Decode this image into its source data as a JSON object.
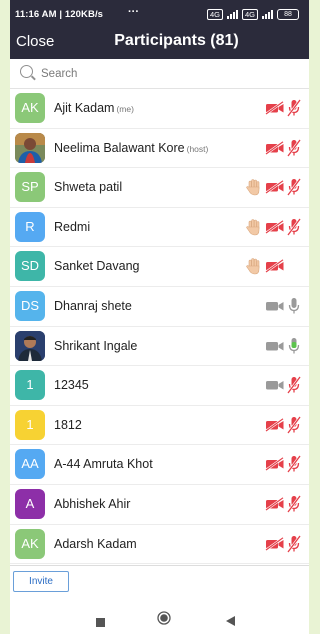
{
  "status_bar": {
    "time": "11:16 AM | 120KB/s",
    "more": "···",
    "net1": "4G",
    "net2": "4G",
    "battery": "88"
  },
  "header": {
    "close_label": "Close",
    "title": "Participants (81)"
  },
  "search": {
    "placeholder": "Search"
  },
  "participants": [
    {
      "initials": "AK",
      "name": "Ajit Kadam",
      "tag": "(me)",
      "avatar_color": "#8bc878",
      "photo": false,
      "hand": false,
      "video": "off",
      "audio": "muted"
    },
    {
      "initials": "",
      "name": "Neelima Balawant Kore",
      "tag": "(host)",
      "avatar_color": "#7a4a36",
      "photo": true,
      "hand": false,
      "video": "off",
      "audio": "muted"
    },
    {
      "initials": "SP",
      "name": "Shweta patil",
      "tag": "",
      "avatar_color": "#8bc878",
      "photo": false,
      "hand": true,
      "video": "off",
      "audio": "muted"
    },
    {
      "initials": "R",
      "name": "Redmi",
      "tag": "",
      "avatar_color": "#55a9f2",
      "photo": false,
      "hand": true,
      "video": "off",
      "audio": "muted"
    },
    {
      "initials": "SD",
      "name": "Sanket Davang",
      "tag": "",
      "avatar_color": "#3eb6a8",
      "photo": false,
      "hand": true,
      "video": "off",
      "audio": "none"
    },
    {
      "initials": "DS",
      "name": "Dhanraj shete",
      "tag": "",
      "avatar_color": "#55b4ec",
      "photo": false,
      "hand": false,
      "video": "on",
      "audio": "on"
    },
    {
      "initials": "",
      "name": "Shrikant Ingale",
      "tag": "",
      "avatar_color": "#2a3f6e",
      "photo": true,
      "hand": false,
      "video": "on",
      "audio": "speaking"
    },
    {
      "initials": "1",
      "name": "12345",
      "tag": "",
      "avatar_color": "#3eb6a8",
      "photo": false,
      "hand": false,
      "video": "on",
      "audio": "muted"
    },
    {
      "initials": "1",
      "name": "1812",
      "tag": "",
      "avatar_color": "#f7d233",
      "photo": false,
      "hand": false,
      "video": "off",
      "audio": "muted"
    },
    {
      "initials": "AA",
      "name": "A-44 Amruta Khot",
      "tag": "",
      "avatar_color": "#55a9f2",
      "photo": false,
      "hand": false,
      "video": "off",
      "audio": "muted"
    },
    {
      "initials": "A",
      "name": "Abhishek Ahir",
      "tag": "",
      "avatar_color": "#8d2fa8",
      "photo": false,
      "hand": false,
      "video": "off",
      "audio": "muted"
    },
    {
      "initials": "AK",
      "name": "Adarsh Kadam",
      "tag": "",
      "avatar_color": "#8bc878",
      "photo": false,
      "hand": false,
      "video": "off",
      "audio": "muted"
    }
  ],
  "footer": {
    "invite_label": "Invite"
  },
  "colors": {
    "header_bg": "#2b2b3b",
    "muted_red": "#e5404a",
    "icon_grey": "#9a9a9a",
    "speaking_green": "#5cc34d",
    "hand_skin": "#f2c9a6"
  }
}
